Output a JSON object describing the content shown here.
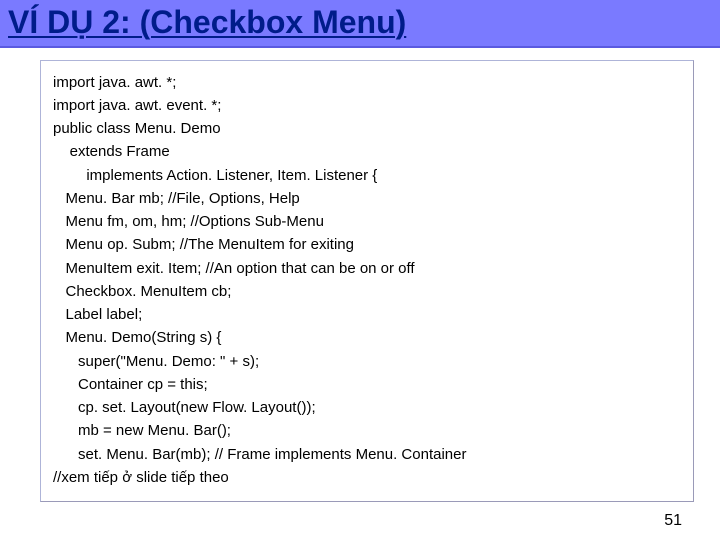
{
  "title": "VÍ DỤ 2: (Checkbox Menu)",
  "code": {
    "l0": "import java. awt. *;",
    "l1": "import java. awt. event. *;",
    "l2": "public class Menu. Demo",
    "l3": "    extends Frame",
    "l4": "        implements Action. Listener, Item. Listener {",
    "l5": "   Menu. Bar mb; //File, Options, Help",
    "l6": "   Menu fm, om, hm; //Options Sub-Menu",
    "l7": "   Menu op. Subm; //The MenuItem for exiting",
    "l8": "   MenuItem exit. Item; //An option that can be on or off",
    "l9": "   Checkbox. MenuItem cb;",
    "l10": "   Label label;",
    "l11": "   Menu. Demo(String s) {",
    "l12": "      super(\"Menu. Demo: \" + s);",
    "l13": "      Container cp = this;",
    "l14": "      cp. set. Layout(new Flow. Layout());",
    "l15": "      mb = new Menu. Bar();",
    "l16": "      set. Menu. Bar(mb); // Frame implements Menu. Container",
    "l17": "//xem tiếp ở slide tiếp theo"
  },
  "page_number": "51"
}
